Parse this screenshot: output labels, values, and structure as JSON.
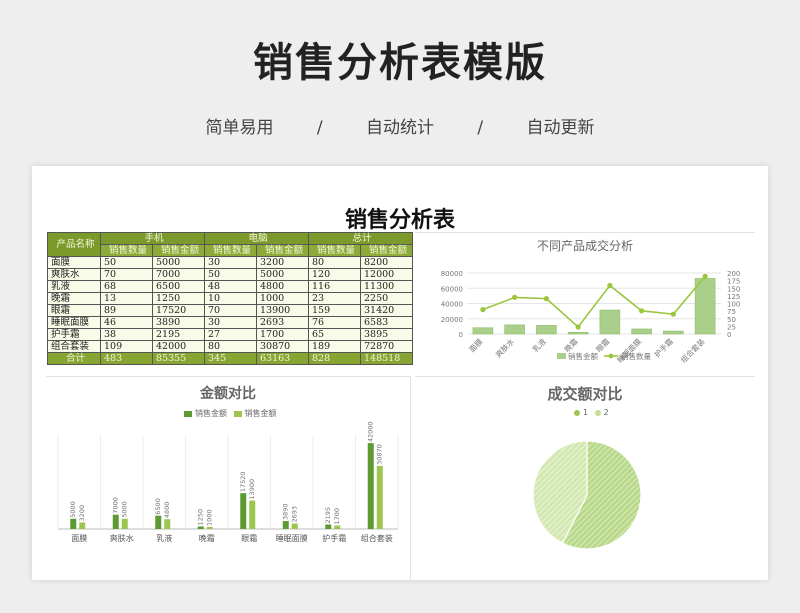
{
  "page": {
    "title": "销售分析表模版",
    "tags": [
      "简单易用",
      "/",
      "自动统计",
      "/",
      "自动更新"
    ]
  },
  "sheet": {
    "title": "销售分析表",
    "header": {
      "name_col": "产品名称",
      "groups": [
        "手机",
        "电脑",
        "总计"
      ],
      "subcols": [
        "销售数量",
        "销售金额",
        "销售数量",
        "销售金额",
        "销售数量",
        "销售金额"
      ]
    },
    "rows": [
      {
        "name": "面膜",
        "values": [
          "50",
          "5000",
          "30",
          "3200",
          "80",
          "8200"
        ]
      },
      {
        "name": "爽肤水",
        "values": [
          "70",
          "7000",
          "50",
          "5000",
          "120",
          "12000"
        ]
      },
      {
        "name": "乳液",
        "values": [
          "68",
          "6500",
          "48",
          "4800",
          "116",
          "11300"
        ]
      },
      {
        "name": "晚霜",
        "values": [
          "13",
          "1250",
          "10",
          "1000",
          "23",
          "2250"
        ]
      },
      {
        "name": "眼霜",
        "values": [
          "89",
          "17520",
          "70",
          "13900",
          "159",
          "31420"
        ]
      },
      {
        "name": "睡眠面膜",
        "values": [
          "46",
          "3890",
          "30",
          "2693",
          "76",
          "6583"
        ]
      },
      {
        "name": "护手霜",
        "values": [
          "38",
          "2195",
          "27",
          "1700",
          "65",
          "3895"
        ]
      },
      {
        "name": "组合套装",
        "values": [
          "109",
          "42000",
          "80",
          "30870",
          "189",
          "72870"
        ]
      }
    ],
    "total": {
      "name": "合计",
      "values": [
        "483",
        "85355",
        "345",
        "63163",
        "828",
        "148518"
      ]
    }
  },
  "colors": {
    "dark_green": "#5e9a32",
    "light_green": "#9cc64e",
    "line_green": "#9bc53d",
    "header_olive": "#7c9a2c"
  },
  "chart_data": [
    {
      "type": "bar",
      "title": "不同产品成交分析",
      "categories": [
        "面膜",
        "爽肤水",
        "乳液",
        "晚霜",
        "眼霜",
        "睡眠面膜",
        "护手霜",
        "组合套装"
      ],
      "series": [
        {
          "name": "销售金额",
          "values": [
            8200,
            12000,
            11300,
            2250,
            31420,
            6583,
            3895,
            72870
          ],
          "axis": "left",
          "render": "bar"
        },
        {
          "name": "销售数量",
          "values": [
            80,
            120,
            116,
            23,
            159,
            76,
            65,
            189
          ],
          "axis": "right",
          "render": "line"
        }
      ],
      "left_ticks": [
        "0",
        "20000",
        "40000",
        "60000",
        "80000"
      ],
      "right_ticks": [
        "0",
        "25",
        "50",
        "75",
        "100",
        "125",
        "150",
        "175",
        "200"
      ],
      "ylim_left": [
        0,
        80000
      ],
      "ylim_right": [
        0,
        200
      ],
      "legend": "bottom"
    },
    {
      "type": "bar",
      "title": "金额对比",
      "categories": [
        "面膜",
        "爽肤水",
        "乳液",
        "晚霜",
        "眼霜",
        "睡眠面膜",
        "护手霜",
        "组合套装"
      ],
      "series": [
        {
          "name": "销售金额",
          "values": [
            5000,
            7000,
            6500,
            1250,
            17520,
            3890,
            2195,
            42000
          ]
        },
        {
          "name": "销售金额",
          "values": [
            3200,
            5000,
            4800,
            1000,
            13900,
            2693,
            1700,
            30870
          ]
        }
      ],
      "data_labels": true,
      "legend": "top"
    },
    {
      "type": "pie",
      "title": "成交额对比",
      "labels": [
        "1",
        "2"
      ],
      "values": [
        85355,
        63163
      ],
      "legend": "top"
    }
  ]
}
